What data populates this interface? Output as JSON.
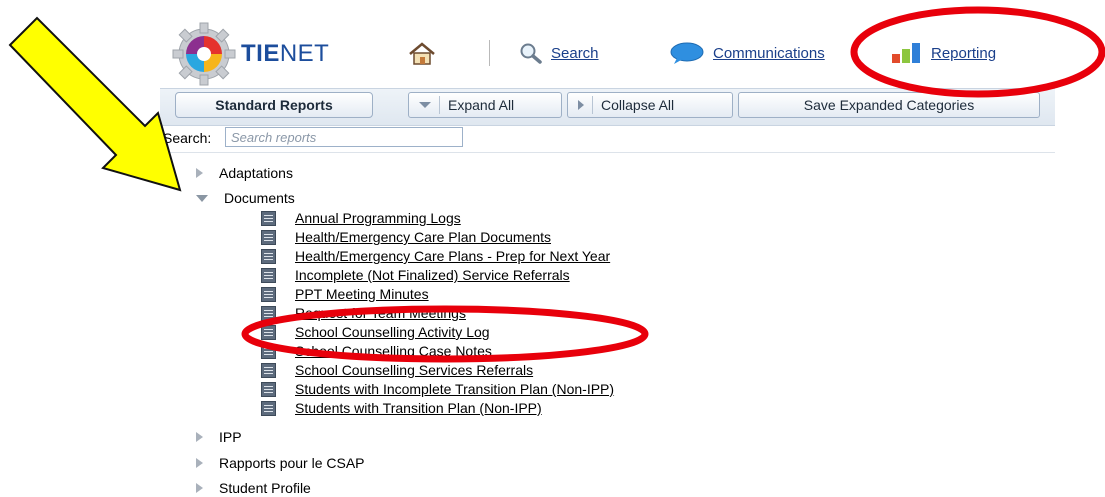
{
  "header": {
    "brand_bold": "TIE",
    "brand_rest": "NET",
    "nav": [
      {
        "label": "Search",
        "icon": "magnifier-icon"
      },
      {
        "label": "Communications",
        "icon": "speech-bubble-icon"
      },
      {
        "label": "Reporting",
        "icon": "bar-chart-icon"
      }
    ]
  },
  "toolbar": {
    "standard_reports": "Standard Reports",
    "expand_all": "Expand All",
    "collapse_all": "Collapse All",
    "save_expanded": "Save Expanded Categories"
  },
  "search": {
    "label": "Search:",
    "placeholder": "Search reports"
  },
  "tree": {
    "categories": [
      {
        "label": "Adaptations",
        "expanded": false
      },
      {
        "label": "Documents",
        "expanded": true
      },
      {
        "label": "IPP",
        "expanded": false
      },
      {
        "label": "Rapports pour le CSAP",
        "expanded": false
      },
      {
        "label": "Student Profile",
        "expanded": false
      }
    ],
    "documents": [
      "Annual Programming Logs",
      "Health/Emergency Care Plan Documents",
      "Health/Emergency Care Plans - Prep for Next Year",
      "Incomplete (Not Finalized) Service Referrals",
      "PPT Meeting Minutes",
      "Request for Team Meetings",
      "School Counselling Activity Log",
      "School Counselling Case Notes",
      "School Counselling Services Referrals",
      "Students with Incomplete Transition Plan (Non-IPP)",
      "Students with Transition Plan (Non-IPP)"
    ]
  },
  "colors": {
    "annotation_red": "#e8000b",
    "arrow_yellow": "#ffff00",
    "link_blue": "#1a3f8a"
  }
}
